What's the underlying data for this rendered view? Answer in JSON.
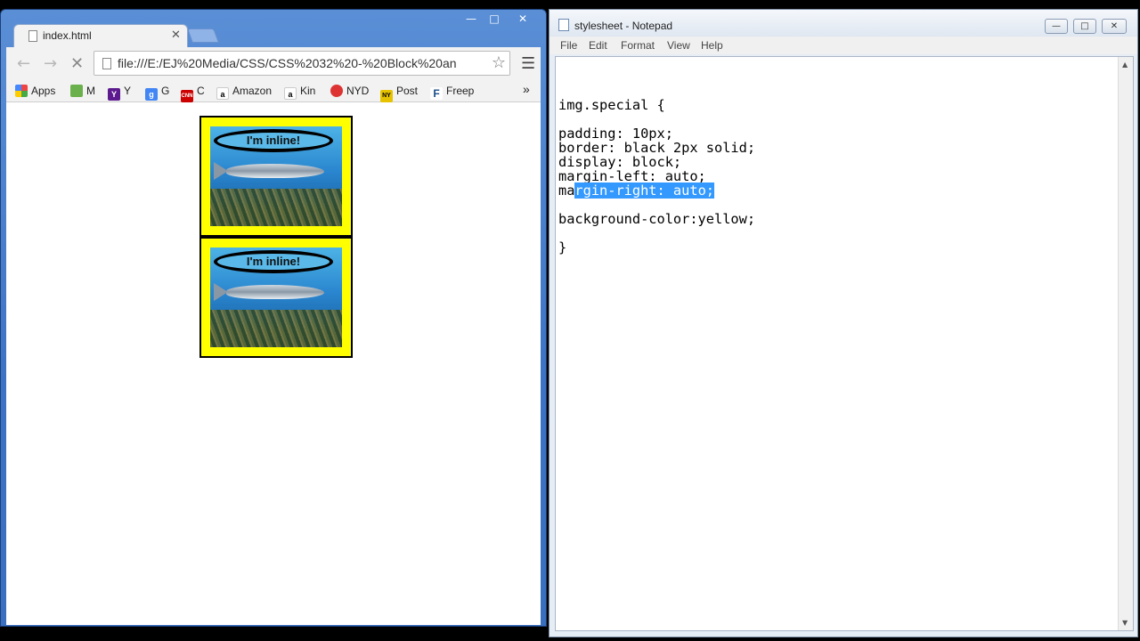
{
  "browser": {
    "tab_title": "index.html",
    "url": "file:///E:/EJ%20Media/CSS/CSS%2032%20-%20Block%20an",
    "bookmarks": [
      {
        "label": "Apps",
        "icon": "apps-grid-icon"
      },
      {
        "label": "M",
        "icon": "m-icon"
      },
      {
        "label": "Y",
        "icon": "yahoo-icon"
      },
      {
        "label": "G",
        "icon": "google-icon"
      },
      {
        "label": "C",
        "icon": "cnn-icon"
      },
      {
        "label": "Amazon",
        "icon": "amazon-icon"
      },
      {
        "label": "Kin",
        "icon": "amazon-icon"
      },
      {
        "label": "NYD",
        "icon": "nyd-icon"
      },
      {
        "label": "Post",
        "icon": "post-icon"
      },
      {
        "label": "Freep",
        "icon": "freep-icon"
      }
    ],
    "overflow": "»",
    "page": {
      "images": [
        {
          "caption": "I'm inline!"
        },
        {
          "caption": "I'm inline!"
        }
      ]
    }
  },
  "notepad": {
    "title": "stylesheet - Notepad",
    "menu": [
      "File",
      "Edit",
      "Format",
      "View",
      "Help"
    ],
    "lines": [
      "",
      "img.special {",
      "",
      "padding: 10px;",
      "border: black 2px solid;",
      "display: block;",
      "margin-left: auto;"
    ],
    "selected_line_prefix": "ma",
    "selected_line_selection": "rgin-right: auto;",
    "lines_after": [
      "",
      "background-color:yellow;",
      "",
      "}"
    ]
  }
}
